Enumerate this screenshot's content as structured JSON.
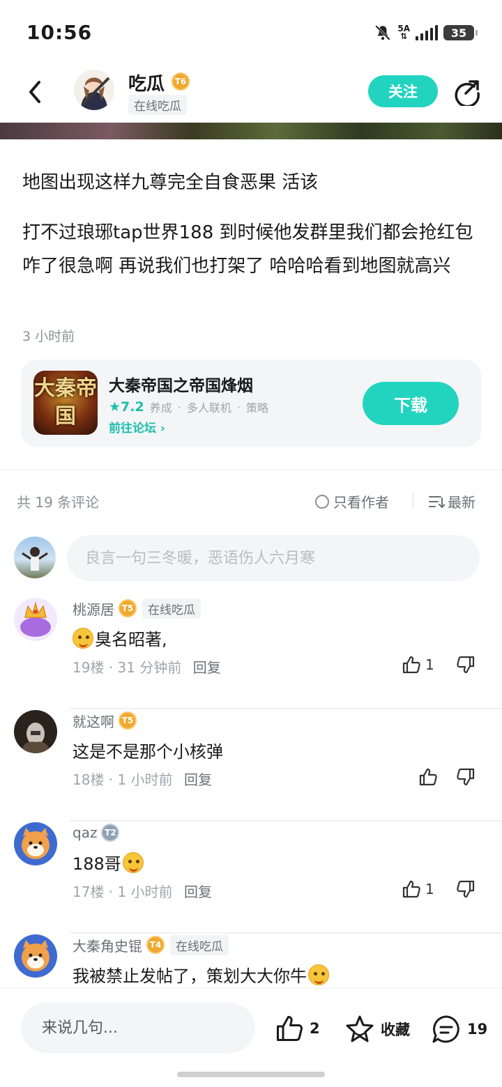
{
  "status": {
    "time": "10:56",
    "network": "5A",
    "battery": "35"
  },
  "header": {
    "author_name": "吃瓜",
    "author_level": "6",
    "online_tag": "在线吃瓜",
    "follow_label": "关注"
  },
  "post": {
    "paragraph1": "地图出现这样九尊完全自食恶果   活该",
    "paragraph2": "打不过琅琊tap世界188   到时候他发群里我们都会抢红包  咋了很急啊   再说我们也打架了 哈哈哈看到地图就高兴",
    "time": "3 小时前"
  },
  "game_card": {
    "title": "大秦帝国之帝国烽烟",
    "score": "7.2",
    "tags": [
      "养成",
      "多人联机",
      "策略"
    ],
    "forum_link": "前往论坛",
    "download_label": "下载",
    "icon_text": "大秦帝国"
  },
  "comments_header": {
    "count_text": "共 19 条评论",
    "only_author": "只看作者",
    "sort": "最新"
  },
  "comment_input": {
    "placeholder": "良言一句三冬暖，恶语伤人六月寒"
  },
  "comments": [
    {
      "name": "桃源居",
      "level": "5",
      "tag": "在线吃瓜",
      "text": "臭名昭著,",
      "floor": "19楼",
      "time": "31 分钟前",
      "reply": "回复",
      "likes": "1"
    },
    {
      "name": "就这啊",
      "level": "5",
      "tag": "",
      "text": "这是不是那个小核弹",
      "floor": "18楼",
      "time": "1 小时前",
      "reply": "回复",
      "likes": ""
    },
    {
      "name": "qaz",
      "level": "2",
      "tag": "",
      "text": "188哥",
      "floor": "17楼",
      "time": "1 小时前",
      "reply": "回复",
      "likes": "1"
    },
    {
      "name": "大秦角史锟",
      "level": "4",
      "tag": "在线吃瓜",
      "text": "我被禁止发帖了，策划大大你牛",
      "floor": "",
      "time": "",
      "reply": "",
      "likes": ""
    }
  ],
  "bottom_bar": {
    "input_placeholder": "来说几句...",
    "like_count": "2",
    "collect_label": "收藏",
    "comment_count": "19"
  },
  "colors": {
    "accent": "#22d4c0",
    "level_gold": "#f0a830",
    "level_gray": "#8fa1b5"
  }
}
